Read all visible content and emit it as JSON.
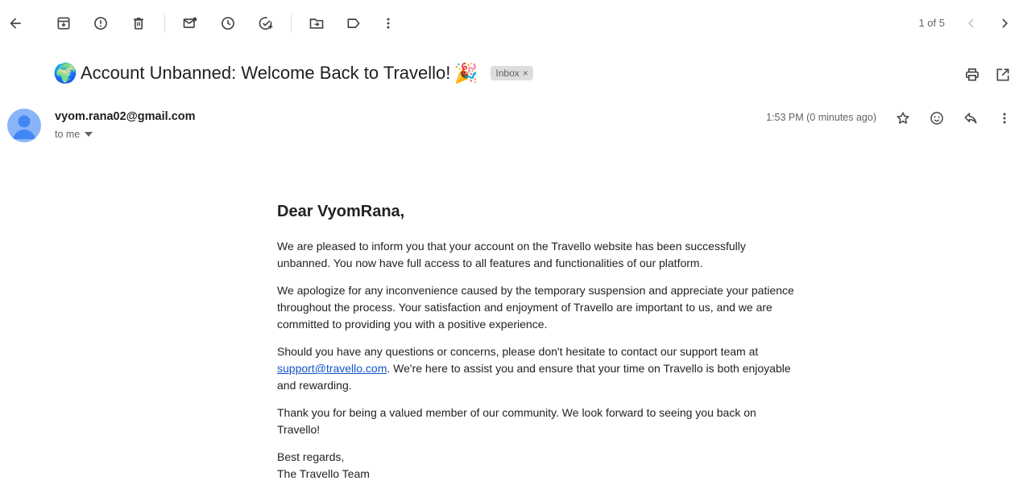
{
  "toolbar": {
    "pager": "1 of 5",
    "icons": [
      "back-arrow-icon",
      "archive-icon",
      "report-spam-icon",
      "delete-icon",
      "mark-unread-icon",
      "snooze-icon",
      "add-task-icon",
      "move-to-icon",
      "label-icon",
      "more-vert-icon",
      "prev-chevron-icon",
      "next-chevron-icon"
    ]
  },
  "email": {
    "subject_emoji_left": "🌍",
    "subject": "Account Unbanned: Welcome Back to Travello!",
    "subject_emoji_right": "🎉",
    "label": "Inbox",
    "label_remove": "×",
    "sender": "vyom.rana02@gmail.com",
    "to": "to me",
    "time": "1:53 PM (0 minutes ago)"
  },
  "body": {
    "greeting": "Dear VyomRana,",
    "p1": "We are pleased to inform you that your account on the Travello website has been successfully unbanned. You now have full access to all features and functionalities of our platform.",
    "p2": "We apologize for any inconvenience caused by the temporary suspension and appreciate your patience throughout the process. Your satisfaction and enjoyment of Travello are important to us, and we are committed to providing you with a positive experience.",
    "p3_before": "Should you have any questions or concerns, please don't hesitate to contact our support team at ",
    "p3_link": "support@travello.com",
    "p3_after": ". We're here to assist you and ensure that your time on Travello is both enjoyable and rewarding.",
    "p4": "Thank you for being a valued member of our community. We look forward to seeing you back on Travello!",
    "closing": "Best regards,",
    "signature": "The Travello Team"
  },
  "colors": {
    "icon": "#444746",
    "muted": "#5f6368",
    "link": "#1155cc",
    "avatar": "#8ab4f8",
    "avatar_figure": "#4285f4",
    "badge_bg": "#dddddd"
  }
}
